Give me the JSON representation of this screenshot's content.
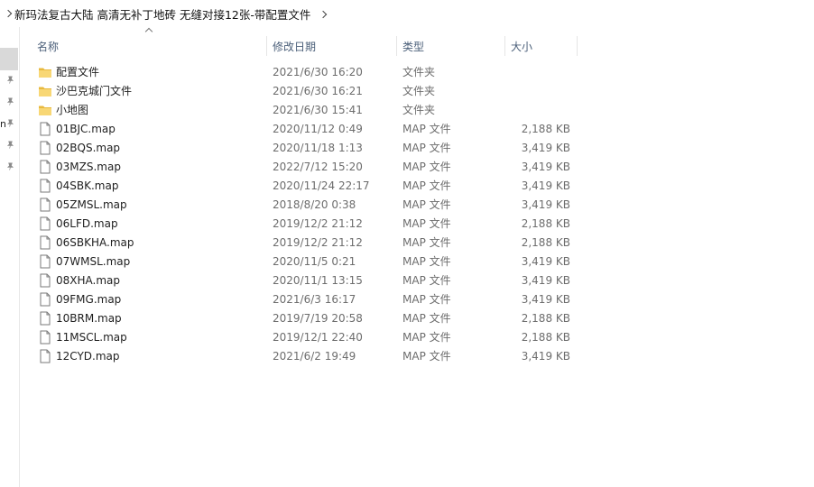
{
  "breadcrumb": {
    "path": "新玛法复古大陆 高清无补丁地砖 无缝对接12张-带配置文件"
  },
  "nav": {
    "clipped_label": "n"
  },
  "columns": {
    "name": "名称",
    "date": "修改日期",
    "type": "类型",
    "size": "大小"
  },
  "files": [
    {
      "name": "配置文件",
      "date": "2021/6/30 16:20",
      "type": "文件夹",
      "size": "",
      "icon": "folder-icon"
    },
    {
      "name": "沙巴克城门文件",
      "date": "2021/6/30 16:21",
      "type": "文件夹",
      "size": "",
      "icon": "folder-icon"
    },
    {
      "name": "小地图",
      "date": "2021/6/30 15:41",
      "type": "文件夹",
      "size": "",
      "icon": "folder-icon"
    },
    {
      "name": "01BJC.map",
      "date": "2020/11/12 0:49",
      "type": "MAP 文件",
      "size": "2,188 KB",
      "icon": "file-icon"
    },
    {
      "name": "02BQS.map",
      "date": "2020/11/18 1:13",
      "type": "MAP 文件",
      "size": "3,419 KB",
      "icon": "file-icon"
    },
    {
      "name": "03MZS.map",
      "date": "2022/7/12 15:20",
      "type": "MAP 文件",
      "size": "3,419 KB",
      "icon": "file-icon"
    },
    {
      "name": "04SBK.map",
      "date": "2020/11/24 22:17",
      "type": "MAP 文件",
      "size": "3,419 KB",
      "icon": "file-icon"
    },
    {
      "name": "05ZMSL.map",
      "date": "2018/8/20 0:38",
      "type": "MAP 文件",
      "size": "3,419 KB",
      "icon": "file-icon"
    },
    {
      "name": "06LFD.map",
      "date": "2019/12/2 21:12",
      "type": "MAP 文件",
      "size": "2,188 KB",
      "icon": "file-icon"
    },
    {
      "name": "06SBKHA.map",
      "date": "2019/12/2 21:12",
      "type": "MAP 文件",
      "size": "2,188 KB",
      "icon": "file-icon"
    },
    {
      "name": "07WMSL.map",
      "date": "2020/11/5 0:21",
      "type": "MAP 文件",
      "size": "3,419 KB",
      "icon": "file-icon"
    },
    {
      "name": "08XHA.map",
      "date": "2020/11/1 13:15",
      "type": "MAP 文件",
      "size": "3,419 KB",
      "icon": "file-icon"
    },
    {
      "name": "09FMG.map",
      "date": "2021/6/3 16:17",
      "type": "MAP 文件",
      "size": "3,419 KB",
      "icon": "file-icon"
    },
    {
      "name": "10BRM.map",
      "date": "2019/7/19 20:58",
      "type": "MAP 文件",
      "size": "2,188 KB",
      "icon": "file-icon"
    },
    {
      "name": "11MSCL.map",
      "date": "2019/12/1 22:40",
      "type": "MAP 文件",
      "size": "2,188 KB",
      "icon": "file-icon"
    },
    {
      "name": "12CYD.map",
      "date": "2021/6/2 19:49",
      "type": "MAP 文件",
      "size": "3,419 KB",
      "icon": "file-icon"
    }
  ],
  "colors": {
    "folder": "#f8d775",
    "folder_dark": "#e8b93e",
    "header_text": "#4c607a",
    "secondary_text": "#6d6d6d"
  }
}
